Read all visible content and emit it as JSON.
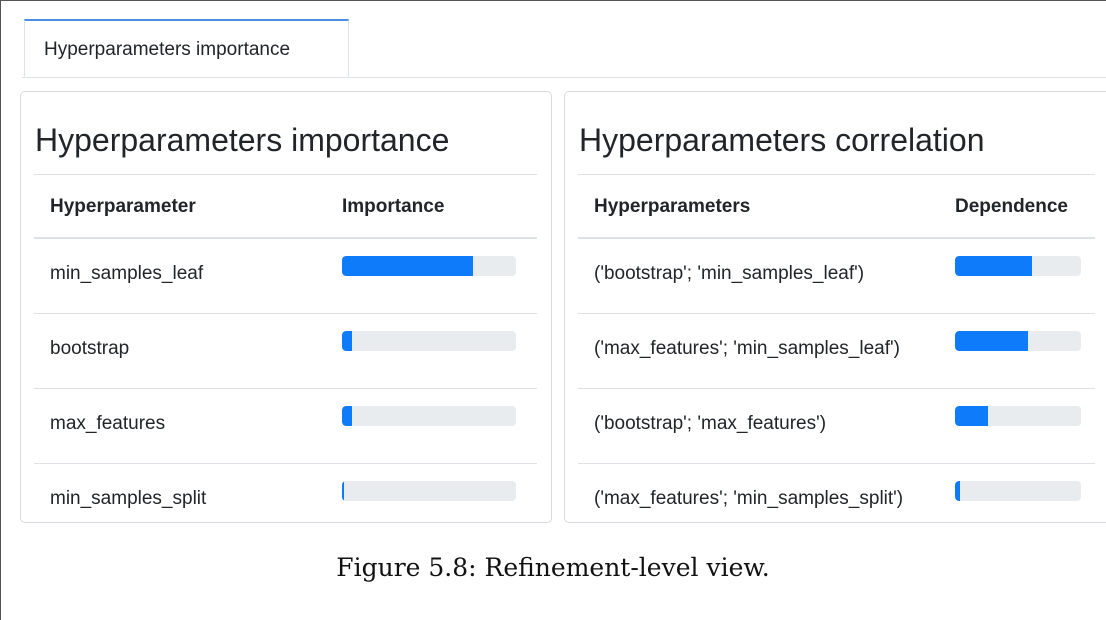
{
  "tabs": [
    {
      "label": "Hyperparameters importance",
      "active": true
    }
  ],
  "importance_card": {
    "title": "Hyperparameters importance",
    "columns": [
      "Hyperparameter",
      "Importance"
    ],
    "rows": [
      {
        "name": "min_samples_leaf",
        "value": 0.75
      },
      {
        "name": "bootstrap",
        "value": 0.06
      },
      {
        "name": "max_features",
        "value": 0.06
      },
      {
        "name": "min_samples_split",
        "value": 0.01
      }
    ]
  },
  "correlation_card": {
    "title": "Hyperparameters correlation",
    "columns": [
      "Hyperparameters",
      "Dependence"
    ],
    "rows": [
      {
        "name": "('bootstrap'; 'min_samples_leaf')",
        "value": 0.61
      },
      {
        "name": "('max_features'; 'min_samples_leaf')",
        "value": 0.58
      },
      {
        "name": "('bootstrap'; 'max_features')",
        "value": 0.26
      },
      {
        "name": "('max_features'; 'min_samples_split')",
        "value": 0.04
      }
    ]
  },
  "caption": "Figure 5.8: Refinement-level view.",
  "colors": {
    "accent": "#0d7bfa",
    "track": "#e9ecef",
    "tab_top": "#4a90e2"
  }
}
